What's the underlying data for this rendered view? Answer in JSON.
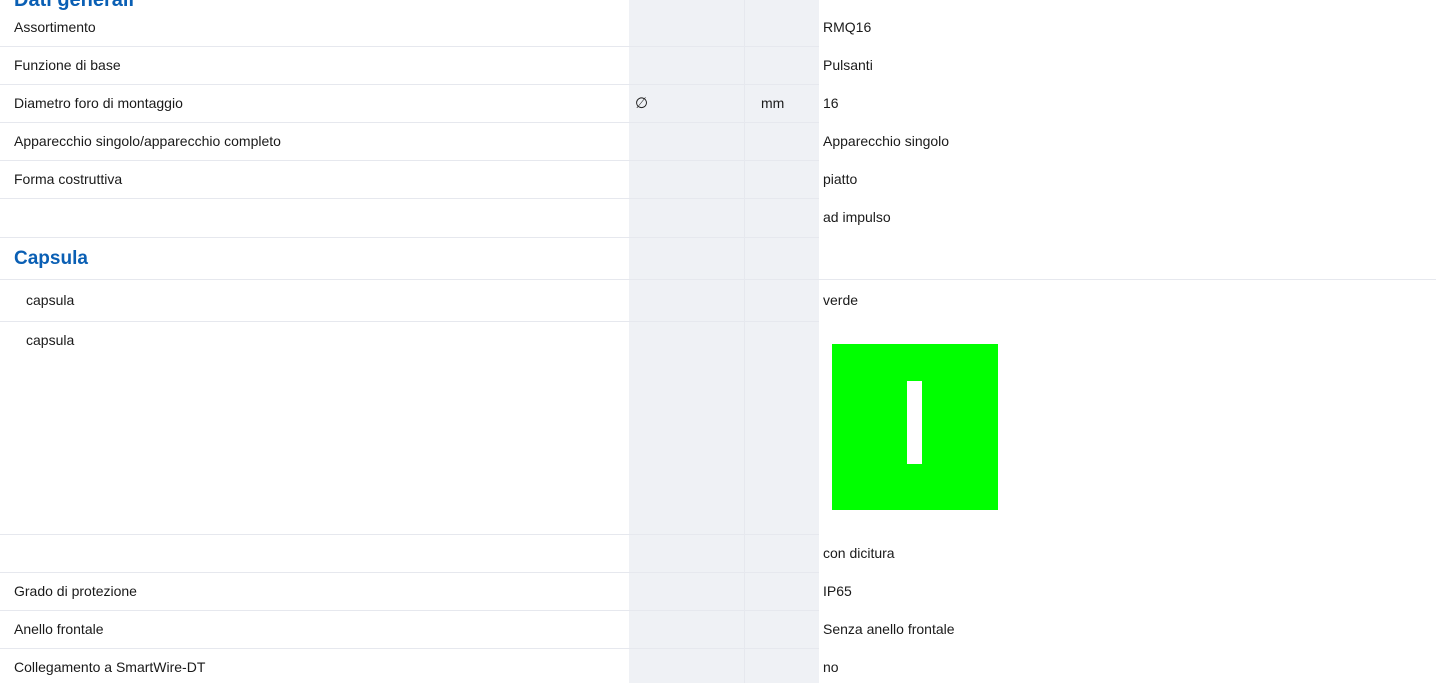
{
  "section_title_partial": "Dati generali",
  "rows": [
    {
      "label": "Assortimento",
      "symbol": "",
      "unit": "",
      "value": "RMQ16"
    },
    {
      "label": "Funzione di base",
      "symbol": "",
      "unit": "",
      "value": "Pulsanti"
    },
    {
      "label": "Diametro foro di montaggio",
      "symbol": "∅",
      "unit": "mm",
      "value": "16"
    },
    {
      "label": "Apparecchio singolo/apparecchio completo",
      "symbol": "",
      "unit": "",
      "value": "Apparecchio singolo"
    },
    {
      "label": "Forma costruttiva",
      "symbol": "",
      "unit": "",
      "value": "piatto"
    },
    {
      "label": "",
      "symbol": "",
      "unit": "",
      "value": "ad impulso"
    }
  ],
  "capsula_section": {
    "title": "Capsula",
    "rows": [
      {
        "label": "capsula",
        "value": "verde"
      },
      {
        "label": "capsula",
        "value_image": "green-cap-with-I-marking",
        "swatch_color": "#00ff00"
      },
      {
        "label": "",
        "value": "con dicitura"
      }
    ]
  },
  "rows_after": [
    {
      "label": "Grado di protezione",
      "value": "IP65"
    },
    {
      "label": "Anello frontale",
      "value": "Senza anello frontale"
    },
    {
      "label": "Collegamento a SmartWire-DT",
      "value": "no"
    }
  ]
}
